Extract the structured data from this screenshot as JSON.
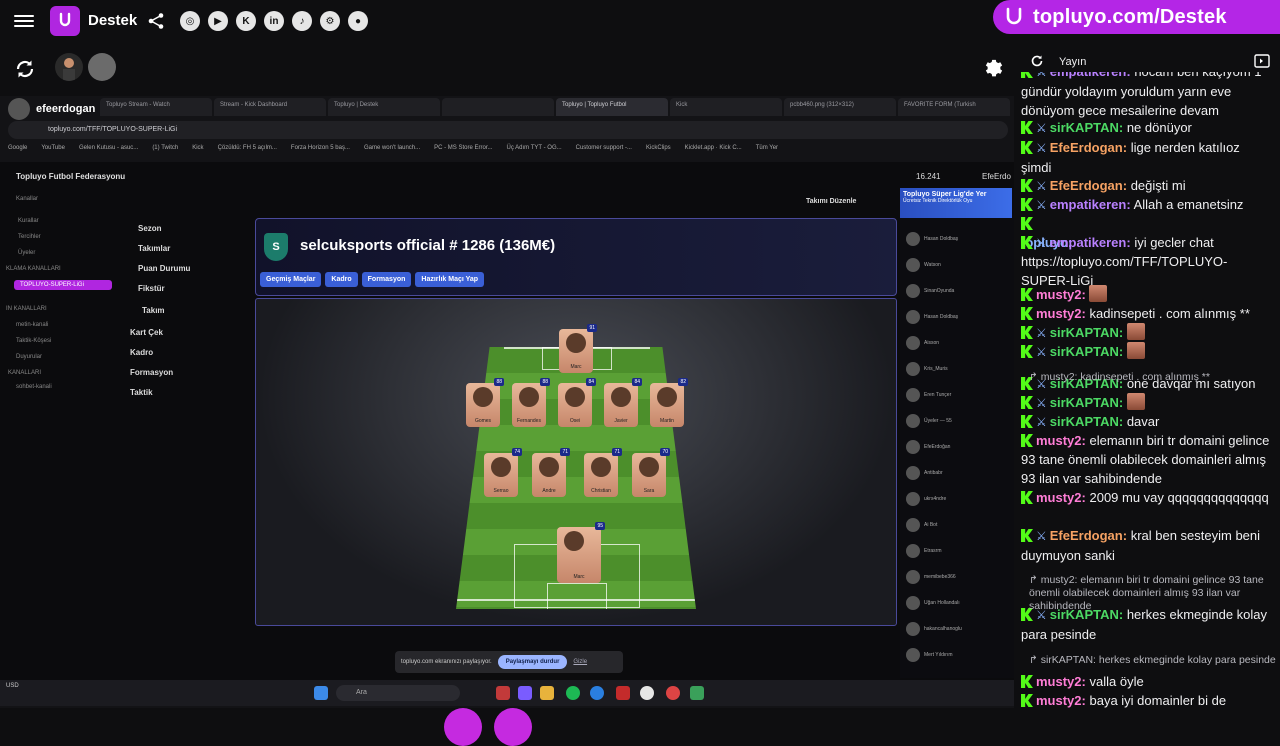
{
  "app": {
    "brand": "Destek",
    "promo_url": "topluyo.com/Destek",
    "social_icons": [
      "instagram-icon",
      "youtube-icon",
      "kick-icon",
      "linkedin-icon",
      "tiktok-icon",
      "steam-icon",
      "github-icon"
    ],
    "social_glyphs": [
      "◎",
      "▶",
      "K",
      "in",
      "♪",
      "⚙",
      "●"
    ]
  },
  "stream": {
    "streamer": "efeerdogan",
    "browser_tabs": [
      "Topluyo Stream - Watch",
      "Stream - Kick Dashboard",
      "Topluyo | Destek",
      "",
      "Topluyo | Topluyo Futbol",
      "Kick",
      "pcbb460.png (312×312)",
      "FAVORITE FORM (Turkish"
    ],
    "address": "topluyo.com/TFF/TOPLUYO-SUPER-LiGi",
    "bookmarks": [
      "Google",
      "YouTube",
      "Gelen Kutusu - asuc...",
      "(1) Twitch",
      "Kick",
      "Çözüldü: FH 5 açılm...",
      "Forza Horizon 5 baş...",
      "Game won't launch...",
      "PC - MS Store Error...",
      "Üç Adım TYT - OG...",
      "Customer support -...",
      "KickClips",
      "Kicklet.app · Kick C...",
      "Tüm Yer"
    ],
    "federation": "Topluyo Futbol Federasyonu",
    "side_items": [
      "Kanallar",
      "Kurallar",
      "Tercihler",
      "Üyeler",
      "TOPLUYO-SUPER-LiGi",
      "metin-kanali",
      "Taktik-Köşesi",
      "Duyurular",
      "sohbet-kanali"
    ],
    "side_heads": [
      "KLAMA KANALLARI",
      "IN KANALLARI",
      "KANALLARI"
    ],
    "menu": [
      "Sezon",
      "Takımlar",
      "Puan Durumu",
      "Fikstür",
      "Takım",
      "Kart Çek",
      "Kadro",
      "Formasyon",
      "Taktik"
    ],
    "top_right_count": "16.241",
    "takim_duzenle": "Takımı Düzenle",
    "team_badge": "S",
    "team_title": "selcuksports official  # 1286 (136M€)",
    "team_buttons": [
      "Geçmiş Maçlar",
      "Kadro",
      "Formasyon",
      "Hazırlık Maçı Yap"
    ],
    "players": [
      {
        "name": "Marc",
        "rating": "91",
        "role": "fw"
      },
      {
        "name": "Gomes",
        "rating": "88",
        "role": "m1"
      },
      {
        "name": "Fernandes",
        "rating": "88",
        "role": "m2"
      },
      {
        "name": "Osei",
        "rating": "84",
        "role": "m3"
      },
      {
        "name": "Javier",
        "rating": "84",
        "role": "m4"
      },
      {
        "name": "Martin",
        "rating": "82",
        "role": "m5"
      },
      {
        "name": "Serrao",
        "rating": "74",
        "role": "d1"
      },
      {
        "name": "Andre",
        "rating": "71",
        "role": "d2"
      },
      {
        "name": "Christian",
        "rating": "71",
        "role": "d3"
      },
      {
        "name": "Sara",
        "rating": "70",
        "role": "d4"
      },
      {
        "name": "Marc",
        "rating": "95",
        "role": "gk"
      }
    ],
    "right_panel_title": "Topluyo Süper Lig'de Yer",
    "right_panel_sub": "Ücretsiz Teknik Direktörlük Oyu",
    "right_panel_users": [
      "Hasan Doldbaş",
      "Watson",
      "SinanOyunda",
      "Hasan Doldbaş",
      "Aisson",
      "Kris_Muris",
      "Eren Tunçer",
      "Üyeler — 55",
      "EfeErdoğan",
      "Antibabr",
      "ukrs4ndre",
      "Ai Bot",
      "Etrasrm",
      "memibebe366",
      "Uğan Hollandalı",
      "hakancalhanoglu",
      "Mert Yıldırım"
    ],
    "share_text": "topluyo.com ekranınızı paylaşıyor.",
    "share_stop": "Paylaşmayı durdur",
    "share_hide": "Gizle",
    "taskbar_search": "Ara",
    "taskbar_left": "USD",
    "top_streamer_name": "EfeErdo"
  },
  "chat": {
    "tab_label": "Yayın",
    "colors": {
      "purple": "#b981ff",
      "green": "#4cd964",
      "orange": "#f6a263",
      "pink": "#ff7dd6",
      "blue": "#8ab4ff",
      "kick": "#53fc18"
    },
    "messages": [
      {
        "user": "empatikeren:",
        "text": "hocam ben kaçıyom 1 gündür yoldayım yoruldum yarın eve dönüyom gece mesailerine devam",
        "color": "purple"
      },
      {
        "user": "sirKAPTAN:",
        "text": "ne dönüyor",
        "color": "green"
      },
      {
        "user": "EfeErdogan:",
        "text": "lige nerden katılıoz şimdi",
        "color": "orange"
      },
      {
        "user": "EfeErdogan:",
        "text": "değişti mi",
        "color": "orange"
      },
      {
        "user": "empatikeren:",
        "text": "Allah a emanetsinz",
        "color": "purple"
      },
      {
        "user": "topluyo:",
        "text": "https://topluyo.com/TFF/TOPLUYO-SUPER-LiGi",
        "color": "blue"
      },
      {
        "user": "empatikeren:",
        "text": "iyi gecler chat",
        "color": "purple"
      },
      {
        "user": "musty2:",
        "text": "",
        "color": "pink"
      },
      {
        "user": "musty2:",
        "text": "kadinsepeti . com alınmış **",
        "color": "pink"
      },
      {
        "user": "sirKAPTAN:",
        "text": "",
        "color": "green"
      },
      {
        "user": "sirKAPTAN:",
        "text": "",
        "color": "green"
      },
      {
        "user": "sirKAPTAN:",
        "text": "one davqar mı satıyon",
        "color": "green"
      },
      {
        "user": "sirKAPTAN:",
        "text": "",
        "color": "green"
      },
      {
        "user": "sirKAPTAN:",
        "text": "davar",
        "color": "green"
      },
      {
        "user": "musty2:",
        "text": "elemanın biri tr domaini gelince 93 tane önemli olabilecek domainleri almış 93 ilan var sahibindende",
        "color": "pink"
      },
      {
        "user": "musty2:",
        "text": "2009 mu vay qqqqqqqqqqqqqq",
        "color": "pink"
      },
      {
        "user": "EfeErdogan:",
        "text": "kral ben sesteyim beni duymuyon sanki",
        "color": "orange"
      },
      {
        "user": "sirKAPTAN:",
        "text": "herkes ekmeginde kolay para pesinde",
        "color": "green"
      },
      {
        "user": "musty2:",
        "text": "valla öyle",
        "color": "pink"
      },
      {
        "user": "musty2:",
        "text": "baya iyi domainler bi de",
        "color": "pink"
      }
    ],
    "replies": [
      "musty2: kadinsepeti . com alınmış **",
      "musty2: elemanın biri tr domaini gelince 93 tane önemli olabilecek domainleri almış 93 ilan var sahibindende",
      "sirKAPTAN: herkes ekmeginde kolay para pesinde"
    ]
  }
}
